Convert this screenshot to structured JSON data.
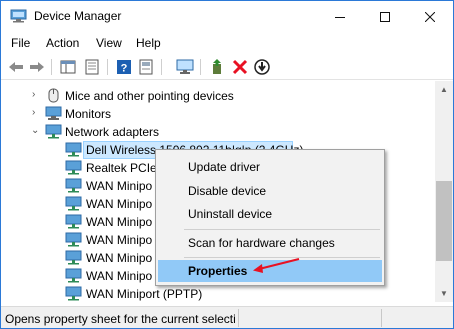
{
  "window": {
    "title": "Device Manager",
    "controls": {
      "minimize": "—",
      "maximize": "☐",
      "close": "✕"
    }
  },
  "menubar": {
    "items": [
      "File",
      "Action",
      "View",
      "Help"
    ]
  },
  "toolbar": {
    "icons": [
      "back-arrow-icon",
      "forward-arrow-icon",
      "show-hide-tree-icon",
      "properties-sheet-icon",
      "help-icon",
      "scan-hardware-icon",
      "monitor-icon",
      "update-driver-icon",
      "uninstall-device-icon",
      "disable-device-icon"
    ]
  },
  "tree": {
    "rows": [
      {
        "label": "Mice and other pointing devices",
        "expander": "›",
        "icon": "mouse-icon"
      },
      {
        "label": "Monitors",
        "expander": "›",
        "icon": "monitor-icon"
      },
      {
        "label": "Network adapters",
        "expander": "⌄",
        "icon": "network-icon"
      },
      {
        "label": "Dell Wireless 1506 802.11b|g|n (2.4GHz)",
        "icon": "network-adapter-icon",
        "selected": true
      },
      {
        "label": "Realtek PCIe",
        "icon": "network-adapter-icon"
      },
      {
        "label": "WAN Minipo",
        "icon": "network-adapter-icon"
      },
      {
        "label": "WAN Minipo",
        "icon": "network-adapter-icon"
      },
      {
        "label": "WAN Minipo",
        "icon": "network-adapter-icon"
      },
      {
        "label": "WAN Minipo",
        "icon": "network-adapter-icon"
      },
      {
        "label": "WAN Minipo",
        "icon": "network-adapter-icon"
      },
      {
        "label": "WAN Minipo",
        "icon": "network-adapter-icon"
      },
      {
        "label": "WAN Miniport (PPTP)",
        "icon": "network-adapter-icon"
      }
    ]
  },
  "context_menu": {
    "items": [
      {
        "label": "Update driver"
      },
      {
        "label": "Disable device"
      },
      {
        "label": "Uninstall device"
      },
      {
        "label": "Scan for hardware changes"
      },
      {
        "label": "Properties",
        "highlighted": true,
        "bold": true
      }
    ],
    "annotation": "red-arrow-pointing-to-properties"
  },
  "statusbar": {
    "text": "Opens property sheet for the current selecti"
  },
  "colors": {
    "selection_bg": "#cce8ff",
    "menu_highlight": "#91c9f7",
    "window_border": "#2b79d7",
    "arrow_red": "#e81123"
  }
}
